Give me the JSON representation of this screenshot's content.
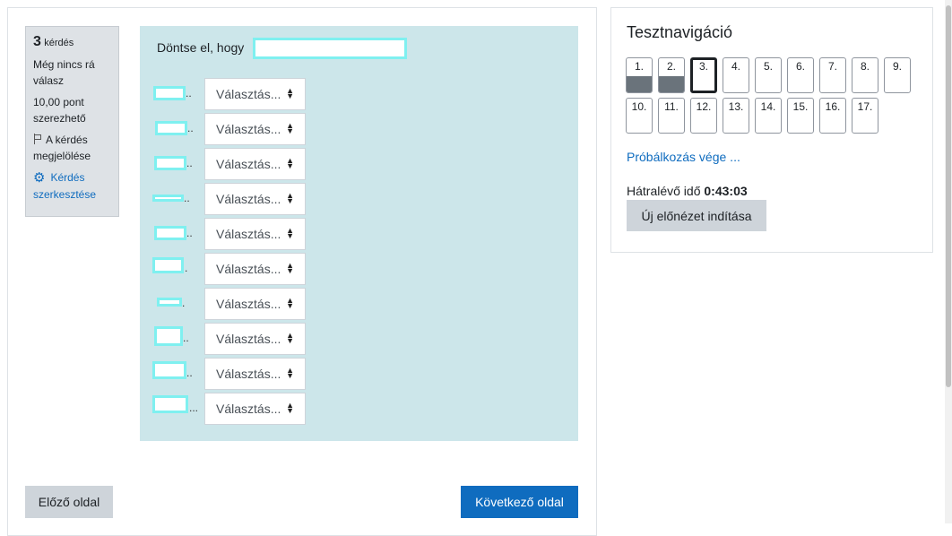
{
  "question_info": {
    "number": "3",
    "number_word": "kérdés",
    "status": "Még nincs rá válasz",
    "points": "10,00 pont szerezhető",
    "flag_label": "A kérdés megjelölése",
    "edit_label": "Kérdés szerkesztése"
  },
  "question": {
    "text": "Döntse el, hogy",
    "rows": [
      {
        "select_label": "Választás...",
        "dots": ".."
      },
      {
        "select_label": "Választás...",
        "dots": ".."
      },
      {
        "select_label": "Választás...",
        "dots": ".."
      },
      {
        "select_label": "Választás...",
        "dots": ".."
      },
      {
        "select_label": "Választás...",
        "dots": ".."
      },
      {
        "select_label": "Választás...",
        "dots": "."
      },
      {
        "select_label": "Választás...",
        "dots": "."
      },
      {
        "select_label": "Választás...",
        "dots": ".."
      },
      {
        "select_label": "Választás...",
        "dots": ".."
      },
      {
        "select_label": "Választás...",
        "dots": "..."
      }
    ]
  },
  "footer": {
    "prev_label": "Előző oldal",
    "next_label": "Következő oldal"
  },
  "navigation": {
    "title": "Tesztnavigáció",
    "questions": [
      {
        "label": "1.",
        "state": "answered"
      },
      {
        "label": "2.",
        "state": "answered"
      },
      {
        "label": "3.",
        "state": "current"
      },
      {
        "label": "4.",
        "state": "empty"
      },
      {
        "label": "5.",
        "state": "empty"
      },
      {
        "label": "6.",
        "state": "empty"
      },
      {
        "label": "7.",
        "state": "empty"
      },
      {
        "label": "8.",
        "state": "empty"
      },
      {
        "label": "9.",
        "state": "empty"
      },
      {
        "label": "10.",
        "state": "empty"
      },
      {
        "label": "11.",
        "state": "empty"
      },
      {
        "label": "12.",
        "state": "empty"
      },
      {
        "label": "13.",
        "state": "empty"
      },
      {
        "label": "14.",
        "state": "empty"
      },
      {
        "label": "15.",
        "state": "empty"
      },
      {
        "label": "16.",
        "state": "empty"
      },
      {
        "label": "17.",
        "state": "empty"
      }
    ],
    "finish_link": "Próbálkozás vége ...",
    "timer_label": "Hátralévő idő",
    "timer_value": "0:43:03",
    "new_preview_label": "Új előnézet indítása"
  },
  "colors": {
    "primary": "#0f6cbf",
    "question_bg": "#cce6ea",
    "answered_fill": "#6a737b"
  }
}
